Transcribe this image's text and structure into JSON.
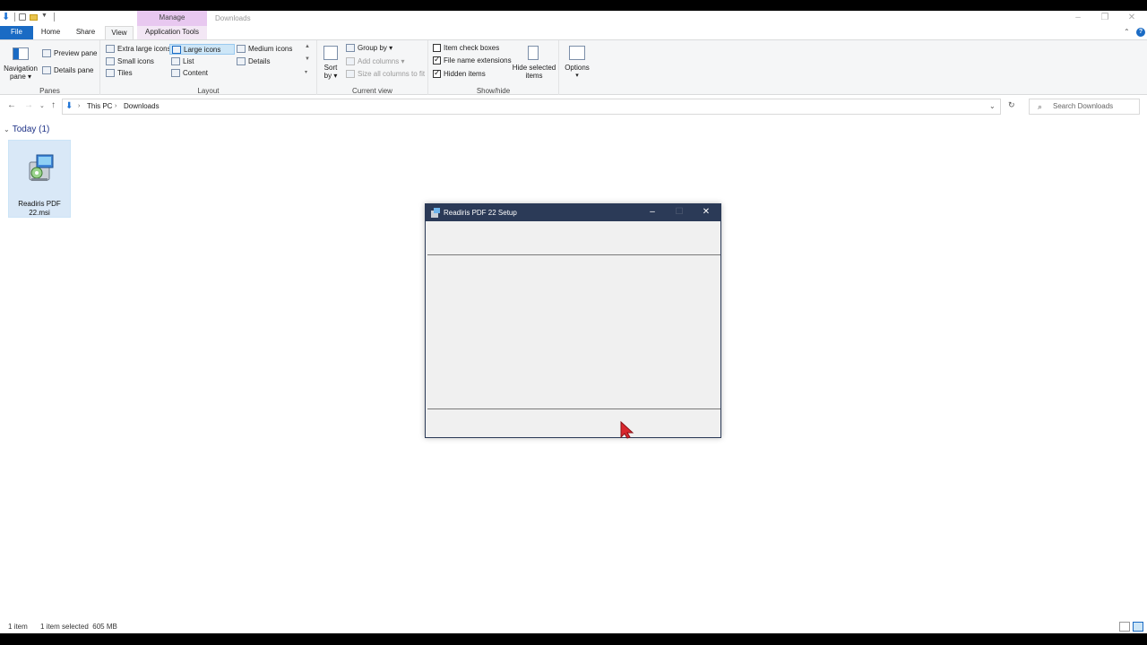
{
  "window": {
    "title": "Downloads",
    "contextual_tab": "Manage",
    "controls": {
      "minimize": "–",
      "restore": "❐",
      "close": "✕"
    }
  },
  "ribbon_tabs": {
    "file": "File",
    "home": "Home",
    "share": "Share",
    "view": "View",
    "application_tools": "Application Tools"
  },
  "ribbon": {
    "panes": {
      "label": "Panes",
      "navigation_pane_1": "Navigation",
      "navigation_pane_2": "pane ▾",
      "preview_pane": "Preview pane",
      "details_pane": "Details pane"
    },
    "layout": {
      "label": "Layout",
      "extra_large_icons": "Extra large icons",
      "large_icons": "Large icons",
      "medium_icons": "Medium icons",
      "small_icons": "Small icons",
      "list": "List",
      "details": "Details",
      "tiles": "Tiles",
      "content": "Content"
    },
    "current_view": {
      "label": "Current view",
      "sort_by_1": "Sort",
      "sort_by_2": "by ▾",
      "group_by": "Group by ▾",
      "add_columns": "Add columns ▾",
      "size_all_columns": "Size all columns to fit"
    },
    "show_hide": {
      "label": "Show/hide",
      "item_check_boxes": "Item check boxes",
      "item_check_boxes_checked": false,
      "file_name_extensions": "File name extensions",
      "file_name_extensions_checked": true,
      "hidden_items": "Hidden items",
      "hidden_items_checked": true,
      "hide_selected_1": "Hide selected",
      "hide_selected_2": "items"
    },
    "options": {
      "label": "Options",
      "caret": "▾"
    }
  },
  "address_bar": {
    "crumbs": [
      "This PC",
      "Downloads"
    ],
    "search_placeholder": "Search Downloads"
  },
  "content": {
    "group_header": "Today (1)",
    "files": [
      {
        "name_line1": "Readiris PDF",
        "name_line2": "22.msi",
        "icon": "msi-installer-icon",
        "selected": true
      }
    ]
  },
  "dialog": {
    "title": "Readiris PDF 22 Setup",
    "controls": {
      "minimize": "–",
      "maximize": "☐",
      "close": "✕"
    }
  },
  "status_bar": {
    "item_count": "1 item",
    "selection": "1 item selected  605 MB"
  },
  "colors": {
    "accent": "#1a6bc4",
    "dialog_title_bg": "#2b3a57",
    "contextual_tab_bg": "#e8c8f0",
    "selection_bg": "#d9e8f7",
    "cursor": "#d9272e"
  }
}
